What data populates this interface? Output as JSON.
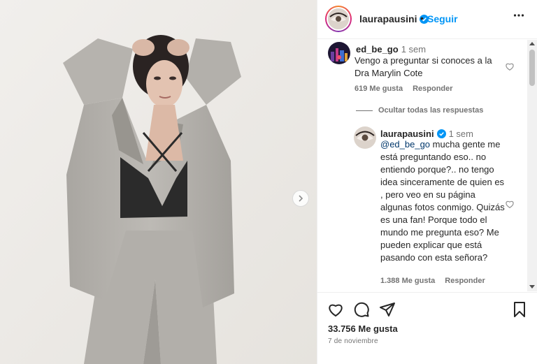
{
  "colors": {
    "accent": "#0095f6",
    "text": "#262626",
    "muted": "#737373",
    "verified": "#0095f6"
  },
  "post": {
    "author": "laurapausini",
    "follow_label": "Seguir",
    "dot": "•",
    "more_label": "•••",
    "likes": "33.756 Me gusta",
    "date": "7 de noviembre"
  },
  "comments": [
    {
      "username": "ed_be_go",
      "time": "1 sem",
      "text": "Vengo a preguntar si conoces a la Dra Marylin Cote",
      "likes": "619 Me gusta",
      "reply_label": "Responder"
    }
  ],
  "hide_replies_label": "Ocultar todas las respuestas",
  "reply": {
    "username": "laurapausini",
    "time": "1 sem",
    "mention": "@ed_be_go",
    "text": " mucha gente me está preguntando eso.. no entiendo porque?.. no tengo idea sinceramente de quien es , pero veo en su página algunas fotos conmigo. Quizás es una fan! Porque todo el mundo me pregunta eso? Me pueden explicar que está pasando con esta señora?",
    "likes": "1.388 Me gusta",
    "reply_label": "Responder"
  },
  "icons": [
    "chevron-right-icon",
    "verified-icon",
    "more-icon",
    "heart-icon",
    "comment-icon",
    "share-icon",
    "bookmark-icon"
  ]
}
